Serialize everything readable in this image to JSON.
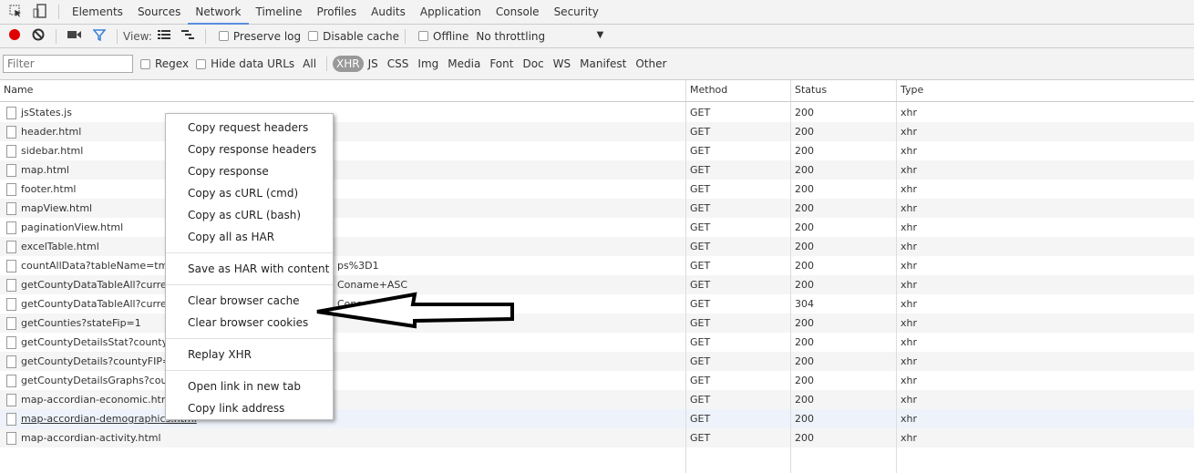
{
  "tabs": [
    "Elements",
    "Sources",
    "Network",
    "Timeline",
    "Profiles",
    "Audits",
    "Application",
    "Console",
    "Security"
  ],
  "active_tab": "Network",
  "toolbar": {
    "view_label": "View:",
    "preserve_log": "Preserve log",
    "disable_cache": "Disable cache",
    "offline": "Offline",
    "throttling": "No throttling"
  },
  "filterbar": {
    "placeholder": "Filter",
    "regex": "Regex",
    "hide_data_urls": "Hide data URLs",
    "types": [
      "All",
      "XHR",
      "JS",
      "CSS",
      "Img",
      "Media",
      "Font",
      "Doc",
      "WS",
      "Manifest",
      "Other"
    ],
    "selected": "XHR"
  },
  "columns": {
    "name": "Name",
    "method": "Method",
    "status": "Status",
    "type": "Type"
  },
  "rows": [
    {
      "name": "jsStates.js",
      "method": "GET",
      "status": "200",
      "type": "xhr"
    },
    {
      "name": "header.html",
      "method": "GET",
      "status": "200",
      "type": "xhr"
    },
    {
      "name": "sidebar.html",
      "method": "GET",
      "status": "200",
      "type": "xhr"
    },
    {
      "name": "map.html",
      "method": "GET",
      "status": "200",
      "type": "xhr"
    },
    {
      "name": "footer.html",
      "method": "GET",
      "status": "200",
      "type": "xhr"
    },
    {
      "name": "mapView.html",
      "method": "GET",
      "status": "200",
      "type": "xhr"
    },
    {
      "name": "paginationView.html",
      "method": "GET",
      "status": "200",
      "type": "xhr"
    },
    {
      "name": "excelTable.html",
      "method": "GET",
      "status": "200",
      "type": "xhr"
    },
    {
      "name": "countAllData?tableName=tmkts",
      "suffix": "ps%3D1",
      "method": "GET",
      "status": "200",
      "type": "xhr"
    },
    {
      "name": "getCountyDataTableAll?currentP",
      "suffix": "Coname+ASC",
      "method": "GET",
      "status": "200",
      "type": "xhr"
    },
    {
      "name": "getCountyDataTableAll?currentP",
      "suffix": "Coname+ASC",
      "method": "GET",
      "status": "304",
      "type": "xhr"
    },
    {
      "name": "getCounties?stateFip=1",
      "method": "GET",
      "status": "200",
      "type": "xhr"
    },
    {
      "name": "getCountyDetailsStat?countyFIP=",
      "method": "GET",
      "status": "200",
      "type": "xhr"
    },
    {
      "name": "getCountyDetails?countyFIP=01",
      "method": "GET",
      "status": "200",
      "type": "xhr"
    },
    {
      "name": "getCountyDetailsGraphs?county",
      "method": "GET",
      "status": "200",
      "type": "xhr"
    },
    {
      "name": "map-accordian-economic.html",
      "method": "GET",
      "status": "200",
      "type": "xhr"
    },
    {
      "name": "map-accordian-demographics.html",
      "method": "GET",
      "status": "200",
      "type": "xhr"
    },
    {
      "name": "map-accordian-activity.html",
      "method": "GET",
      "status": "200",
      "type": "xhr"
    }
  ],
  "menu": [
    [
      "Copy request headers",
      "Copy response headers",
      "Copy response",
      "Copy as cURL (cmd)",
      "Copy as cURL (bash)",
      "Copy all as HAR"
    ],
    [
      "Save as HAR with content"
    ],
    [
      "Clear browser cache",
      "Clear browser cookies"
    ],
    [
      "Replay XHR"
    ],
    [
      "Open link in new tab",
      "Copy link address"
    ]
  ],
  "colors": {
    "record": "#e00000",
    "accent": "#5a8de0",
    "selected_row": "#eef3fb"
  }
}
